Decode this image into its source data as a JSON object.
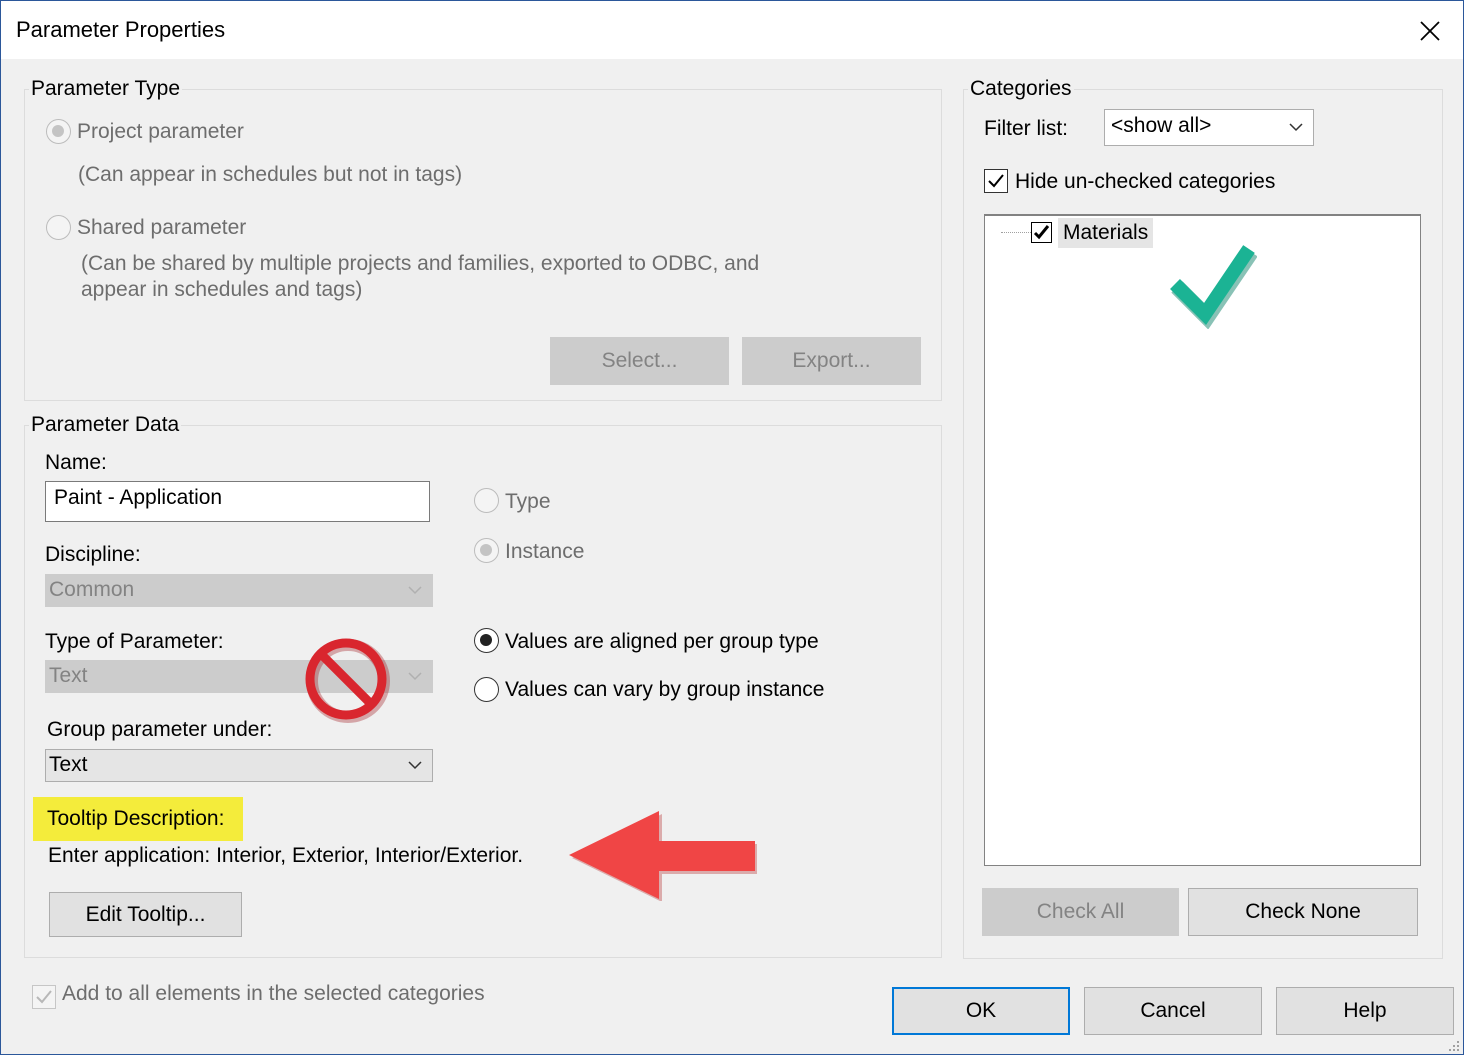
{
  "window": {
    "title": "Parameter Properties"
  },
  "parameter_type": {
    "label": "Parameter Type",
    "project_label": "Project parameter",
    "project_desc": "(Can appear in schedules but not in tags)",
    "shared_label": "Shared parameter",
    "shared_desc_line1": "(Can be shared by multiple projects and families, exported to ODBC, and",
    "shared_desc_line2": "appear in schedules and tags)",
    "select_button": "Select...",
    "export_button": "Export..."
  },
  "parameter_data": {
    "label": "Parameter Data",
    "name_label": "Name:",
    "name_value": "Paint - Application",
    "discipline_label": "Discipline:",
    "discipline_value": "Common",
    "type_label": "Type of Parameter:",
    "type_value": "Text",
    "group_label": "Group parameter under:",
    "group_value": "Text",
    "type_radio": "Type",
    "instance_radio": "Instance",
    "aligned_radio": "Values are aligned per group type",
    "vary_radio": "Values can vary by group instance",
    "tooltip_label": "Tooltip Description:",
    "tooltip_text": "Enter application: Interior, Exterior, Interior/Exterior.",
    "edit_tooltip_button": "Edit Tooltip..."
  },
  "categories": {
    "label": "Categories",
    "filter_label": "Filter list:",
    "filter_value": "<show all>",
    "hide_unchecked_label": "Hide un-checked categories",
    "items": [
      {
        "label": "Materials",
        "checked": true
      }
    ],
    "check_all_button": "Check All",
    "check_none_button": "Check None"
  },
  "footer": {
    "add_all_label": "Add to all elements in the selected categories",
    "ok_button": "OK",
    "cancel_button": "Cancel",
    "help_button": "Help"
  },
  "colors": {
    "accent_border": "#2b579a",
    "highlight_yellow": "#f4ec3b",
    "arrow_red": "#f04545",
    "check_teal": "#1bb394",
    "no_sign_red": "#d9262e"
  }
}
